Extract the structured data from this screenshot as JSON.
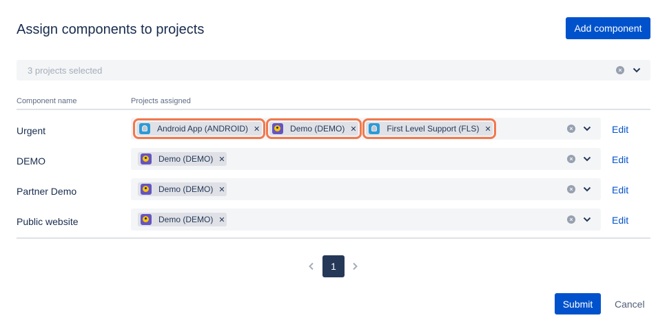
{
  "dialog": {
    "title": "Assign components to projects",
    "add_component_label": "Add component"
  },
  "project_select": {
    "placeholder": "3 projects selected"
  },
  "table": {
    "headers": [
      "Component name",
      "Projects assigned"
    ],
    "rows": [
      {
        "name": "Urgent",
        "projects": [
          {
            "label": "Android App (ANDROID)",
            "icon": "android-project-icon"
          },
          {
            "label": "Demo (DEMO)",
            "icon": "demo-project-icon"
          },
          {
            "label": "First Level Support (FLS)",
            "icon": "fls-project-icon"
          }
        ],
        "edit_label": "Edit"
      },
      {
        "name": "DEMO",
        "projects": [
          {
            "label": "Demo (DEMO)",
            "icon": "demo-project-icon"
          }
        ],
        "edit_label": "Edit"
      },
      {
        "name": "Partner Demo",
        "projects": [
          {
            "label": "Demo (DEMO)",
            "icon": "demo-project-icon"
          }
        ],
        "edit_label": "Edit"
      },
      {
        "name": "Public website",
        "projects": [
          {
            "label": "Demo (DEMO)",
            "icon": "demo-project-icon"
          }
        ],
        "edit_label": "Edit"
      }
    ]
  },
  "pagination": {
    "current_page": "1"
  },
  "footer": {
    "submit_label": "Submit",
    "cancel_label": "Cancel"
  },
  "colors": {
    "primary": "#0052cc",
    "field_bg": "#f4f5f7",
    "tag_bg": "#dfe1e6",
    "highlight": "#f2784b",
    "page_active": "#253858"
  }
}
